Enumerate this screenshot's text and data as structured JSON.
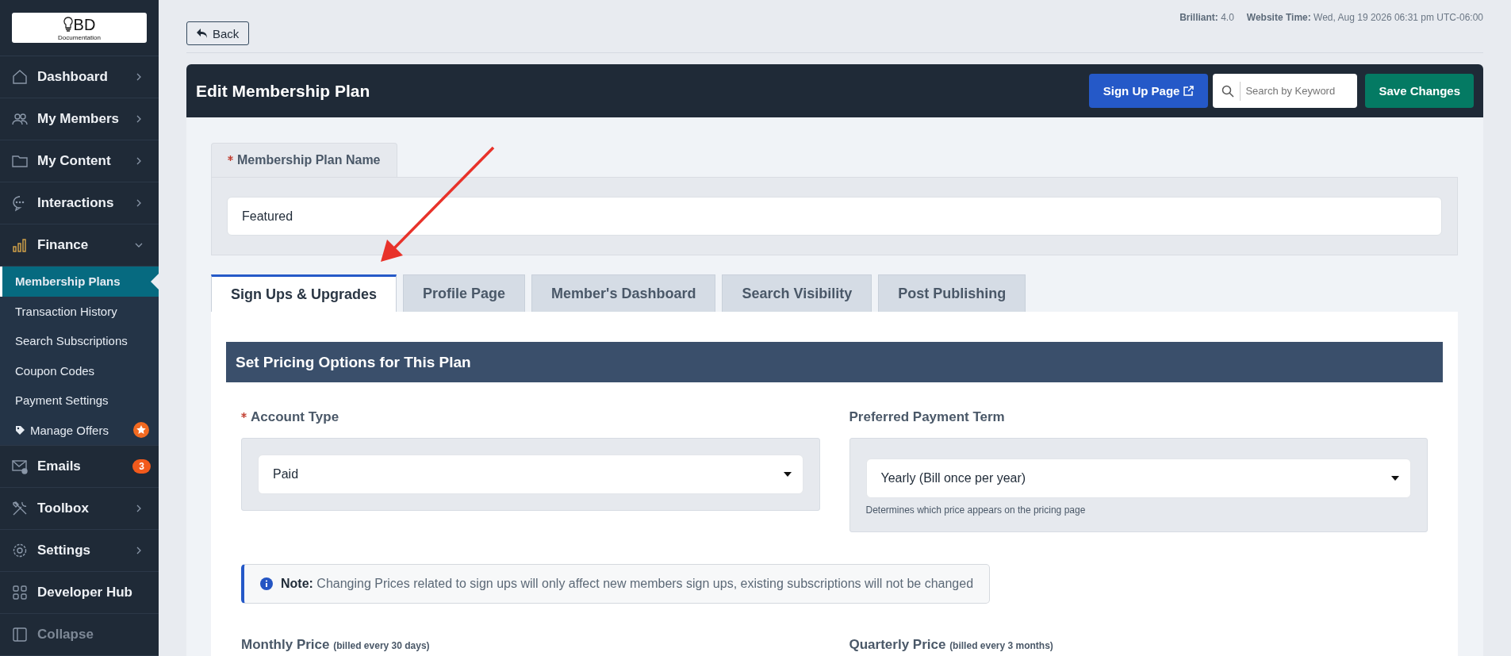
{
  "sidebar": {
    "logo": {
      "title": "BD",
      "subtitle": "Documentation"
    },
    "items": [
      {
        "label": "Dashboard",
        "kind": "group",
        "expanded": false
      },
      {
        "label": "My Members",
        "kind": "group",
        "expanded": false
      },
      {
        "label": "My Content",
        "kind": "group",
        "expanded": false
      },
      {
        "label": "Interactions",
        "kind": "group",
        "expanded": false
      },
      {
        "label": "Finance",
        "kind": "group",
        "expanded": true,
        "children": [
          {
            "label": "Membership Plans",
            "kind": "link",
            "selected": true
          },
          {
            "label": "Transaction History",
            "kind": "link",
            "selected": false
          },
          {
            "label": "Search Subscriptions",
            "kind": "link",
            "selected": false
          },
          {
            "label": "Coupon Codes",
            "kind": "link",
            "selected": false
          },
          {
            "label": "Payment Settings",
            "kind": "link",
            "selected": false
          },
          {
            "label": "Manage Offers",
            "kind": "tagged",
            "selected": false
          }
        ]
      },
      {
        "label": "Emails",
        "kind": "link",
        "badge": "3"
      },
      {
        "label": "Toolbox",
        "kind": "group",
        "expanded": false
      },
      {
        "label": "Settings",
        "kind": "group",
        "expanded": false
      },
      {
        "label": "Developer Hub",
        "kind": "link"
      },
      {
        "label": "Collapse",
        "kind": "toggle"
      }
    ]
  },
  "top_bar": {
    "back_button": "Back",
    "meta": [
      {
        "label": "Brilliant:",
        "value": "4.0"
      },
      {
        "label": "Website Time:",
        "value": "Wed, Aug 19 2026 06:31 pm UTC-06:00"
      }
    ]
  },
  "header": {
    "title": "Edit Membership Plan",
    "sign_up_button": "Sign Up Page",
    "search": {
      "placeholder": "Search by Keyword"
    },
    "save_button": "Save Changes"
  },
  "plan_name": {
    "label": "Membership Plan Name",
    "required": true,
    "value": "Featured"
  },
  "tabs": [
    {
      "label": "Sign Ups & Upgrades",
      "selected": true
    },
    {
      "label": "Profile Page",
      "selected": false
    },
    {
      "label": "Member's Dashboard",
      "selected": false
    },
    {
      "label": "Search Visibility",
      "selected": false
    },
    {
      "label": "Post Publishing",
      "selected": false
    }
  ],
  "section_title": "Set Pricing Options for This Plan",
  "selects": [
    {
      "label": "Account Type",
      "required": true,
      "value": "Paid"
    },
    {
      "label": "Preferred Payment Term",
      "required": false,
      "value": "Yearly (Bill once per year)",
      "help": "Determines which price appears on the pricing page"
    }
  ],
  "note": "**Note:** Changing Prices related to sign ups will only affect new members sign ups, existing subscriptions will not be changed",
  "prices": [
    {
      "label": "Monthly Price",
      "detail": "(billed every 30 days)"
    },
    {
      "label": "Quarterly Price",
      "detail": "(billed every 3 months)"
    }
  ]
}
